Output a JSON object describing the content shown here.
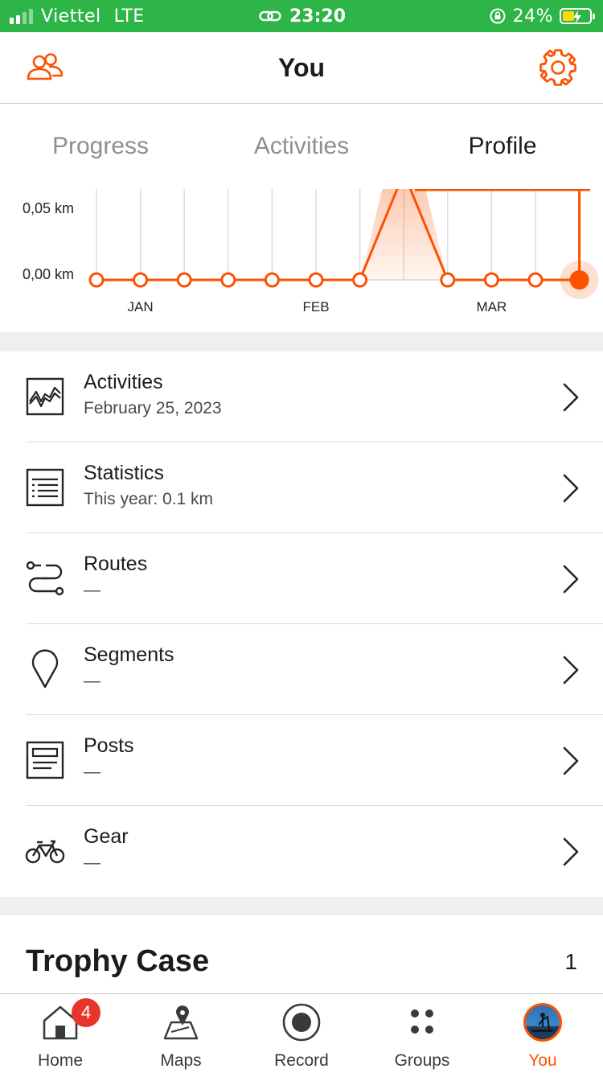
{
  "status_bar": {
    "carrier": "Viettel",
    "network": "LTE",
    "time": "23:20",
    "battery_percent": "24%"
  },
  "header": {
    "title": "You",
    "left_icon": "people-icon",
    "right_icon": "gear-icon"
  },
  "tabs": [
    {
      "label": "Progress",
      "active": false
    },
    {
      "label": "Activities",
      "active": false
    },
    {
      "label": "Profile",
      "active": true
    }
  ],
  "chart_data": {
    "type": "line",
    "yticks": [
      "0,05 km",
      "0,00 km"
    ],
    "xticks": [
      "JAN",
      "FEB",
      "MAR"
    ],
    "x": [
      "w1",
      "w2",
      "w3",
      "w4",
      "w5",
      "w6",
      "w7",
      "w8",
      "w9",
      "w10",
      "w11",
      "w12"
    ],
    "values": [
      0,
      0,
      0,
      0,
      0,
      0,
      0,
      0.1,
      0,
      0,
      0,
      0
    ],
    "highlight_index": 11,
    "accent": "#fc5200",
    "grid": true
  },
  "list": [
    {
      "title": "Activities",
      "subtitle": "February 25, 2023",
      "icon": "activity-graph-icon"
    },
    {
      "title": "Statistics",
      "subtitle": "This year: 0.1 km",
      "icon": "statistics-list-icon"
    },
    {
      "title": "Routes",
      "subtitle": "—",
      "icon": "routes-icon"
    },
    {
      "title": "Segments",
      "subtitle": "—",
      "icon": "map-pin-icon"
    },
    {
      "title": "Posts",
      "subtitle": "—",
      "icon": "posts-icon"
    },
    {
      "title": "Gear",
      "subtitle": "—",
      "icon": "bike-icon"
    }
  ],
  "trophy": {
    "title": "Trophy Case",
    "count": "1"
  },
  "tabbar": [
    {
      "label": "Home",
      "icon": "home-icon",
      "badge": "4"
    },
    {
      "label": "Maps",
      "icon": "maps-icon"
    },
    {
      "label": "Record",
      "icon": "record-icon"
    },
    {
      "label": "Groups",
      "icon": "groups-icon"
    },
    {
      "label": "You",
      "icon": "avatar-icon",
      "active": true
    }
  ],
  "colors": {
    "accent": "#fc5200",
    "status_bar": "#2eb548",
    "badge": "#e8352b"
  }
}
